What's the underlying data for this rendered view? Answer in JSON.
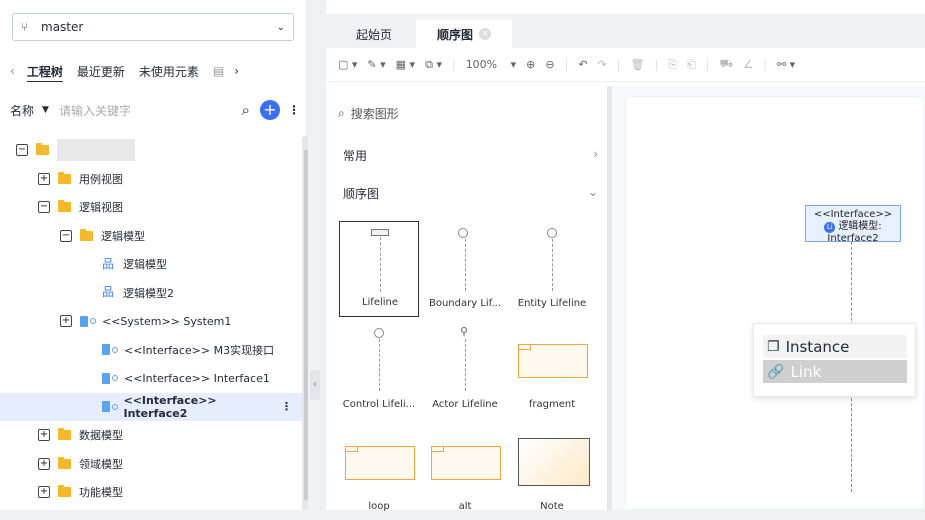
{
  "left": {
    "branch": "master",
    "tabs": [
      "工程树",
      "最近更新",
      "未使用元素"
    ],
    "filter_label": "名称",
    "search_placeholder": "请输入关键字",
    "tree": [
      {
        "label": "",
        "toggle": "−",
        "type": "folder",
        "indent": 0
      },
      {
        "label": "用例视图",
        "toggle": "+",
        "type": "folder",
        "indent": 1
      },
      {
        "label": "逻辑视图",
        "toggle": "−",
        "type": "folder",
        "indent": 1
      },
      {
        "label": "逻辑模型",
        "toggle": "−",
        "type": "folder",
        "indent": 2
      },
      {
        "label": "逻辑模型",
        "toggle": "",
        "type": "diagram",
        "indent": 3
      },
      {
        "label": "逻辑模型2",
        "toggle": "",
        "type": "diagram",
        "indent": 3
      },
      {
        "label": "<<System>> System1",
        "toggle": "+",
        "type": "interface",
        "indent": 2
      },
      {
        "label": "<<Interface>> M3实现接口",
        "toggle": "",
        "type": "interface",
        "indent": 3
      },
      {
        "label": "<<Interface>> Interface1",
        "toggle": "",
        "type": "interface",
        "indent": 3
      },
      {
        "label": "<<Interface>> Interface2",
        "toggle": "",
        "type": "interface",
        "indent": 3,
        "selected": true
      },
      {
        "label": "数据模型",
        "toggle": "+",
        "type": "folder",
        "indent": 1
      },
      {
        "label": "领域模型",
        "toggle": "+",
        "type": "folder",
        "indent": 1
      },
      {
        "label": "功能模型",
        "toggle": "+",
        "type": "folder",
        "indent": 1
      }
    ]
  },
  "right": {
    "tabs": [
      "起始页",
      "顺序图"
    ],
    "zoom": "100%",
    "palette": {
      "search_placeholder": "搜索图形",
      "section_common": "常用",
      "section_seq": "顺序图",
      "shapes": [
        "Lifeline",
        "Boundary Lif...",
        "Entity Lifeline",
        "Control Lifeli...",
        "Actor Lifeline",
        "fragment",
        "loop",
        "alt",
        "Note"
      ]
    },
    "canvas": {
      "interface_stereo": "<<Interface>>",
      "interface_name1": "逻辑模型:",
      "interface_name2": "Interface2"
    },
    "context_menu": [
      "Instance",
      "Link"
    ]
  },
  "colors": {
    "accent": "#3b6ff5",
    "folder": "#f5b82a",
    "selection": "#e6edff"
  }
}
